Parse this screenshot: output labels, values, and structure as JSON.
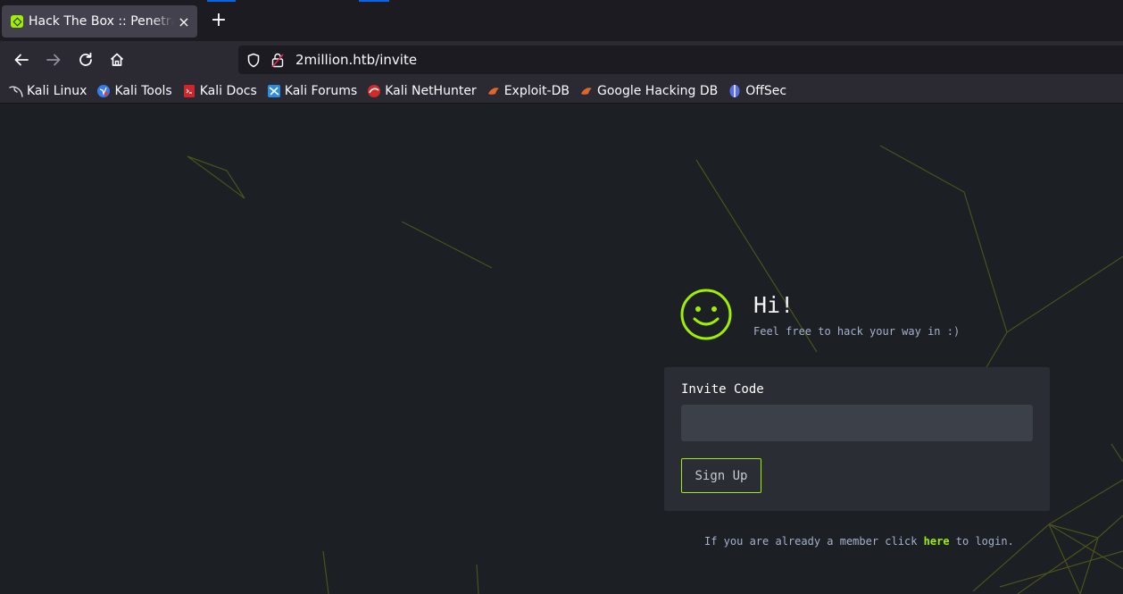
{
  "browser": {
    "tab_title": "Hack The Box :: Penetration Testing Labs",
    "close_glyph": "×",
    "new_tab_glyph": "+",
    "url": "2million.htb/invite",
    "bookmarks": [
      {
        "label": "Kali Linux",
        "icon": "kali-dragon-icon",
        "color": "#2a2a2a"
      },
      {
        "label": "Kali Tools",
        "icon": "kali-tools-icon",
        "color": "#367bf0"
      },
      {
        "label": "Kali Docs",
        "icon": "kali-docs-icon",
        "color": "#d0252b"
      },
      {
        "label": "Kali Forums",
        "icon": "kali-forums-icon",
        "color": "#2b8de2"
      },
      {
        "label": "Kali NetHunter",
        "icon": "nethunter-icon",
        "color": "#d02a2a"
      },
      {
        "label": "Exploit-DB",
        "icon": "exploit-db-icon",
        "color": "#e0672a"
      },
      {
        "label": "Google Hacking DB",
        "icon": "ghdb-icon",
        "color": "#e0672a"
      },
      {
        "label": "OffSec",
        "icon": "offsec-icon",
        "color": "#5b6ee1"
      }
    ]
  },
  "page": {
    "greeting": "Hi!",
    "tagline": "Feel free to hack your way in :)",
    "form": {
      "label": "Invite Code",
      "value": "",
      "button": "Sign Up"
    },
    "login_prefix": "If you are already a member click ",
    "login_link": "here",
    "login_suffix": " to login."
  },
  "colors": {
    "accent": "#9fef00",
    "background": "#1c1f23",
    "card": "#2a2d33",
    "muted_text": "#a4b1cd"
  }
}
